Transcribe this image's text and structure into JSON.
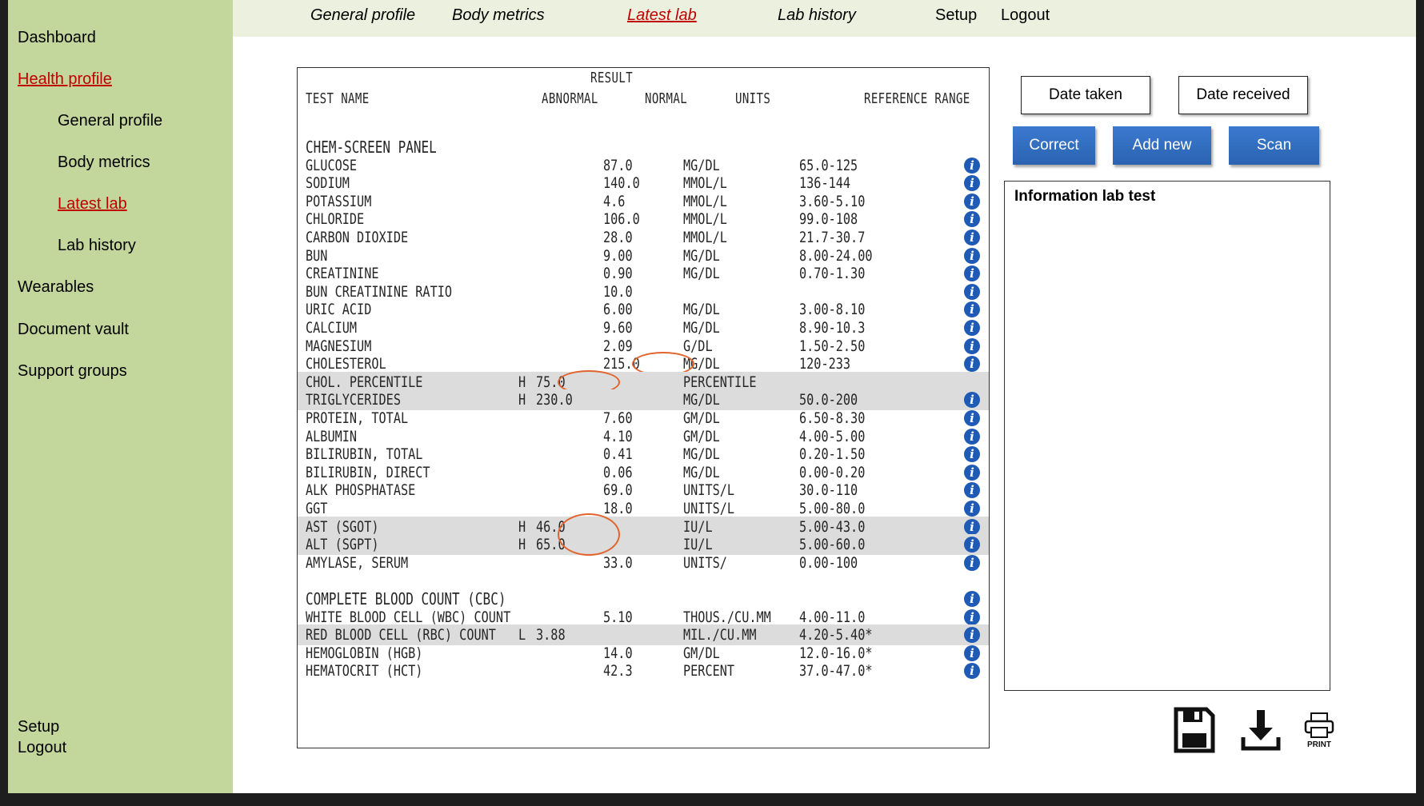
{
  "sidebar": {
    "items": [
      {
        "label": "Dashboard"
      },
      {
        "label": "Health profile"
      },
      {
        "label": "General profile"
      },
      {
        "label": "Body metrics"
      },
      {
        "label": "Latest lab"
      },
      {
        "label": "Lab history"
      },
      {
        "label": "Wearables"
      },
      {
        "label": "Document vault"
      },
      {
        "label": "Support groups"
      }
    ],
    "setup": "Setup",
    "logout": "Logout"
  },
  "topnav": {
    "items": [
      {
        "label": "General profile"
      },
      {
        "label": "Body metrics"
      },
      {
        "label": "Latest lab"
      },
      {
        "label": "Lab history"
      },
      {
        "label": "Setup"
      },
      {
        "label": "Logout"
      }
    ]
  },
  "report": {
    "headers": {
      "result": "RESULT",
      "test_name": "TEST NAME",
      "abnormal": "ABNORMAL",
      "normal": "NORMAL",
      "units": "UNITS",
      "reference_range": "REFERENCE RANGE"
    },
    "rows": [
      {
        "name": "CHEM-SCREEN PANEL",
        "section": true
      },
      {
        "name": "GLUCOSE",
        "normal": "87.0",
        "units": "MG/DL",
        "range": "65.0-125",
        "info": true
      },
      {
        "name": "SODIUM",
        "normal": "140.0",
        "units": "MMOL/L",
        "range": "136-144",
        "info": true
      },
      {
        "name": "POTASSIUM",
        "normal": "4.6",
        "units": "MMOL/L",
        "range": "3.60-5.10",
        "info": true
      },
      {
        "name": "CHLORIDE",
        "normal": "106.0",
        "units": "MMOL/L",
        "range": "99.0-108",
        "info": true
      },
      {
        "name": "CARBON DIOXIDE",
        "normal": "28.0",
        "units": "MMOL/L",
        "range": "21.7-30.7",
        "info": true
      },
      {
        "name": "BUN",
        "normal": "9.00",
        "units": "MG/DL",
        "range": "8.00-24.00",
        "info": true
      },
      {
        "name": "CREATININE",
        "normal": "0.90",
        "units": "MG/DL",
        "range": "0.70-1.30",
        "info": true
      },
      {
        "name": "BUN CREATININE RATIO",
        "normal": "10.0",
        "info": true
      },
      {
        "name": "URIC ACID",
        "normal": "6.00",
        "units": "MG/DL",
        "range": "3.00-8.10",
        "info": true
      },
      {
        "name": "CALCIUM",
        "normal": "9.60",
        "units": "MG/DL",
        "range": "8.90-10.3",
        "info": true
      },
      {
        "name": "MAGNESIUM",
        "normal": "2.09",
        "units": "G/DL",
        "range": "1.50-2.50",
        "info": true
      },
      {
        "name": "CHOLESTEROL",
        "normal": "215.0",
        "units": "MG/DL",
        "range": "120-233",
        "info": true,
        "circle": "normal"
      },
      {
        "name": "CHOL. PERCENTILE",
        "flag": "H",
        "abnormal": "75.0",
        "units": "PERCENTILE",
        "shade": true,
        "circle": "abnormal"
      },
      {
        "name": "TRIGLYCERIDES",
        "flag": "H",
        "abnormal": "230.0",
        "units": "MG/DL",
        "range": "50.0-200",
        "info": true,
        "shade": true
      },
      {
        "name": "PROTEIN, TOTAL",
        "normal": "7.60",
        "units": "GM/DL",
        "range": "6.50-8.30",
        "info": true
      },
      {
        "name": "ALBUMIN",
        "normal": "4.10",
        "units": "GM/DL",
        "range": "4.00-5.00",
        "info": true
      },
      {
        "name": "BILIRUBIN, TOTAL",
        "normal": "0.41",
        "units": "MG/DL",
        "range": "0.20-1.50",
        "info": true
      },
      {
        "name": "BILIRUBIN, DIRECT",
        "normal": "0.06",
        "units": "MG/DL",
        "range": "0.00-0.20",
        "info": true
      },
      {
        "name": "ALK PHOSPHATASE",
        "normal": "69.0",
        "units": "UNITS/L",
        "range": "30.0-110",
        "info": true
      },
      {
        "name": "GGT",
        "normal": "18.0",
        "units": "UNITS/L",
        "range": "5.00-80.0",
        "info": true
      },
      {
        "name": "AST (SGOT)",
        "flag": "H",
        "abnormal": "46.0",
        "units": "IU/L",
        "range": "5.00-43.0",
        "info": true,
        "shade": true
      },
      {
        "name": "ALT (SGPT)",
        "flag": "H",
        "abnormal": "65.0",
        "units": "IU/L",
        "range": "5.00-60.0",
        "info": true,
        "shade": true
      },
      {
        "name": "AMYLASE, SERUM",
        "normal": "33.0",
        "units": "UNITS/",
        "range": "0.00-100",
        "info": true
      },
      {
        "name": "",
        "spacer": true
      },
      {
        "name": "COMPLETE BLOOD COUNT (CBC)",
        "section": true,
        "info": true
      },
      {
        "name": "WHITE BLOOD CELL (WBC) COUNT",
        "normal": "5.10",
        "units": "THOUS./CU.MM",
        "range": "4.00-11.0",
        "info": true
      },
      {
        "name": "RED BLOOD CELL (RBC) COUNT",
        "flag": "L",
        "abnormal": "3.88",
        "units": "MIL./CU.MM",
        "range": "4.20-5.40*",
        "info": true,
        "shade": true
      },
      {
        "name": "HEMOGLOBIN (HGB)",
        "normal": "14.0",
        "units": "GM/DL",
        "range": "12.0-16.0*",
        "info": true
      },
      {
        "name": "HEMATOCRIT (HCT)",
        "normal": "42.3",
        "units": "PERCENT",
        "range": "37.0-47.0*",
        "info": true
      }
    ]
  },
  "buttons": {
    "date_taken": "Date taken",
    "date_received": "Date received",
    "correct": "Correct",
    "add_new": "Add new",
    "scan": "Scan"
  },
  "info_panel": {
    "title": "Information lab test"
  },
  "bottom_icons": {
    "save": "save-icon",
    "download": "download-icon",
    "print": "print-icon",
    "print_label": "PRINT"
  },
  "colors": {
    "sidebar": "#c3d69b",
    "topnav": "#ebf1de",
    "active_link": "#c00000",
    "button_blue": "#2e6dc0",
    "highlight_circle": "#e0642c"
  }
}
